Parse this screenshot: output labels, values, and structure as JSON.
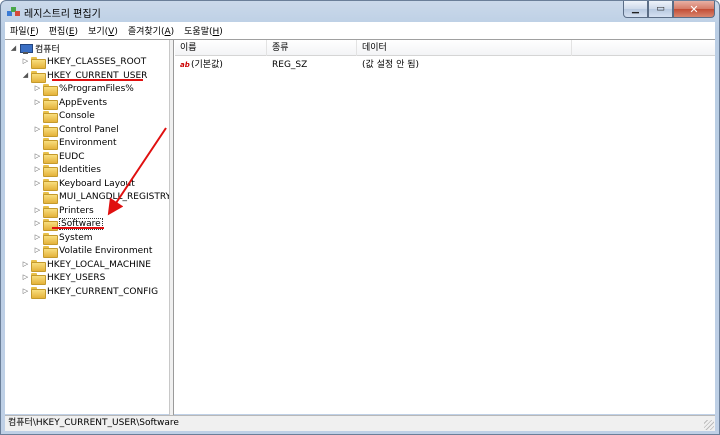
{
  "window": {
    "title": "레지스트리 편집기"
  },
  "menu": [
    {
      "label": "파일(",
      "key": "F",
      "end": ")"
    },
    {
      "label": "편집(",
      "key": "E",
      "end": ")"
    },
    {
      "label": "보기(",
      "key": "V",
      "end": ")"
    },
    {
      "label": "즐겨찾기(",
      "key": "A",
      "end": ")"
    },
    {
      "label": "도움말(",
      "key": "H",
      "end": ")"
    }
  ],
  "tree": {
    "root": "컴퓨터",
    "items": [
      {
        "label": "HKEY_CLASSES_ROOT"
      },
      {
        "label": "HKEY_CURRENT_USER"
      },
      {
        "label": "%ProgramFiles%"
      },
      {
        "label": "AppEvents"
      },
      {
        "label": "Console"
      },
      {
        "label": "Control Panel"
      },
      {
        "label": "Environment"
      },
      {
        "label": "EUDC"
      },
      {
        "label": "Identities"
      },
      {
        "label": "Keyboard Layout"
      },
      {
        "label": "MUI_LANGDLL_REGISTRY"
      },
      {
        "label": "Printers"
      },
      {
        "label": "Software"
      },
      {
        "label": "System"
      },
      {
        "label": "Volatile Environment"
      },
      {
        "label": "HKEY_LOCAL_MACHINE"
      },
      {
        "label": "HKEY_USERS"
      },
      {
        "label": "HKEY_CURRENT_CONFIG"
      }
    ]
  },
  "list": {
    "columns": [
      "이름",
      "종류",
      "데이터"
    ],
    "rows": [
      {
        "icon": "ab",
        "name": "(기본값)",
        "type": "REG_SZ",
        "data": "(값 설정 안 됨)"
      }
    ]
  },
  "status": {
    "path": "컴퓨터\\HKEY_CURRENT_USER\\Software"
  },
  "colors": {
    "annotation": "#e01010",
    "frame": "#bfd0e6"
  }
}
